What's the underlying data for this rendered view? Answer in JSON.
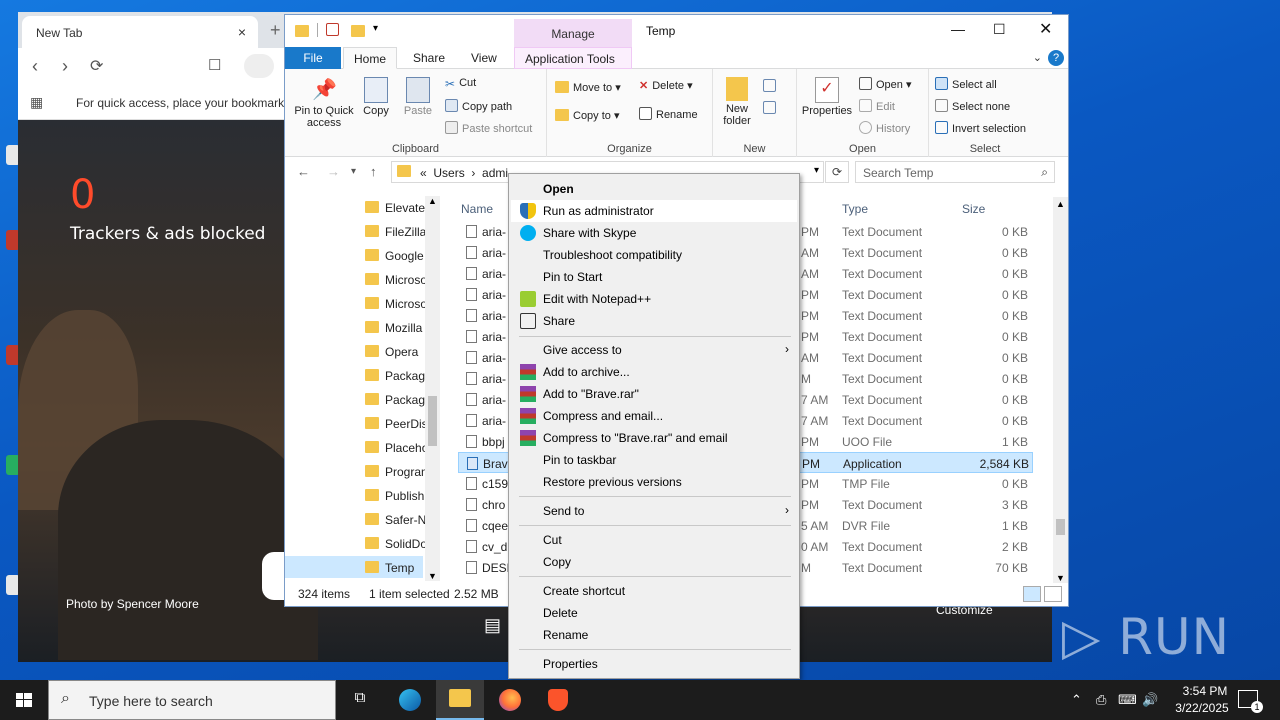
{
  "browser": {
    "tab_title": "New Tab",
    "tab_close": "×",
    "new_tab": "+",
    "bookmarks_hint": "For quick access, place your bookmarks",
    "trackers_count": "0",
    "trackers_label": "Trackers & ads blocked",
    "photo_credit": "Photo by Spencer Moore",
    "customize": "Customize"
  },
  "explorer": {
    "window_title": "Temp",
    "manage_tab": "Manage",
    "ribbon_tabs": [
      "File",
      "Home",
      "Share",
      "View",
      "Application Tools"
    ],
    "help": "?",
    "clipboard": {
      "label": "Clipboard",
      "pin_quick_access": "Pin to Quick access",
      "copy": "Copy",
      "paste": "Paste",
      "cut": "Cut",
      "copy_path": "Copy path",
      "paste_shortcut": "Paste shortcut"
    },
    "organize": {
      "label": "Organize",
      "move_to": "Move to",
      "copy_to": "Copy to",
      "delete": "Delete",
      "rename": "Rename"
    },
    "new": {
      "label": "New",
      "new_folder": "New folder"
    },
    "open": {
      "label": "Open",
      "properties": "Properties",
      "open": "Open",
      "edit": "Edit",
      "history": "History"
    },
    "select": {
      "label": "Select",
      "select_all": "Select all",
      "select_none": "Select none",
      "invert_selection": "Invert selection"
    },
    "address": {
      "prefix": "«",
      "crumb1": "Users",
      "crumb_sep": "›",
      "crumb2": "admi"
    },
    "search_placeholder": "Search Temp",
    "nav_items": [
      "Elevate",
      "FileZilla",
      "Google",
      "Microso",
      "Microso",
      "Mozilla",
      "Opera",
      "Packag",
      "Packag",
      "PeerDis",
      "Placeho",
      "Program",
      "Publish",
      "Safer-N",
      "SolidDo",
      "Temp"
    ],
    "columns": {
      "name": "Name",
      "type": "Type",
      "size": "Size"
    },
    "files": [
      {
        "name": "aria-",
        "date": "PM",
        "type": "Text Document",
        "size": "0 KB"
      },
      {
        "name": "aria-",
        "date": "AM",
        "type": "Text Document",
        "size": "0 KB"
      },
      {
        "name": "aria-",
        "date": "AM",
        "type": "Text Document",
        "size": "0 KB"
      },
      {
        "name": "aria-",
        "date": "PM",
        "type": "Text Document",
        "size": "0 KB"
      },
      {
        "name": "aria-",
        "date": "PM",
        "type": "Text Document",
        "size": "0 KB"
      },
      {
        "name": "aria-",
        "date": "PM",
        "type": "Text Document",
        "size": "0 KB"
      },
      {
        "name": "aria-",
        "date": "AM",
        "type": "Text Document",
        "size": "0 KB"
      },
      {
        "name": "aria-",
        "date": "M",
        "type": "Text Document",
        "size": "0 KB"
      },
      {
        "name": "aria-",
        "date": "7 AM",
        "type": "Text Document",
        "size": "0 KB"
      },
      {
        "name": "aria-",
        "date": "7 AM",
        "type": "Text Document",
        "size": "0 KB"
      },
      {
        "name": "bbpj",
        "date": "PM",
        "type": "UOO File",
        "size": "1 KB"
      },
      {
        "name": "Brav",
        "date": "PM",
        "type": "Application",
        "size": "2,584 KB"
      },
      {
        "name": "c159",
        "date": "PM",
        "type": "TMP File",
        "size": "0 KB"
      },
      {
        "name": "chro",
        "date": "PM",
        "type": "Text Document",
        "size": "3 KB"
      },
      {
        "name": "cqee",
        "date": "5 AM",
        "type": "DVR File",
        "size": "1 KB"
      },
      {
        "name": "cv_d",
        "date": "0 AM",
        "type": "Text Document",
        "size": "2 KB"
      },
      {
        "name": "DESK",
        "date": "M",
        "type": "Text Document",
        "size": "70 KB"
      }
    ],
    "status": {
      "items": "324 items",
      "selected": "1 item selected",
      "size": "2.52 MB"
    }
  },
  "context_menu": {
    "open": "Open",
    "run_as_admin": "Run as administrator",
    "share_skype": "Share with Skype",
    "troubleshoot": "Troubleshoot compatibility",
    "pin_start": "Pin to Start",
    "edit_notepadpp": "Edit with Notepad++",
    "share": "Share",
    "give_access": "Give access to",
    "add_archive": "Add to archive...",
    "add_brave_rar": "Add to \"Brave.rar\"",
    "compress_email": "Compress and email...",
    "compress_brave_email": "Compress to \"Brave.rar\" and email",
    "pin_taskbar": "Pin to taskbar",
    "restore_versions": "Restore previous versions",
    "send_to": "Send to",
    "cut": "Cut",
    "copy": "Copy",
    "create_shortcut": "Create shortcut",
    "delete": "Delete",
    "rename": "Rename",
    "properties": "Properties"
  },
  "taskbar": {
    "search_placeholder": "Type here to search",
    "time": "3:54 PM",
    "date": "3/22/2025",
    "notification_count": "1"
  },
  "watermark": "ANY ▷ RUN"
}
